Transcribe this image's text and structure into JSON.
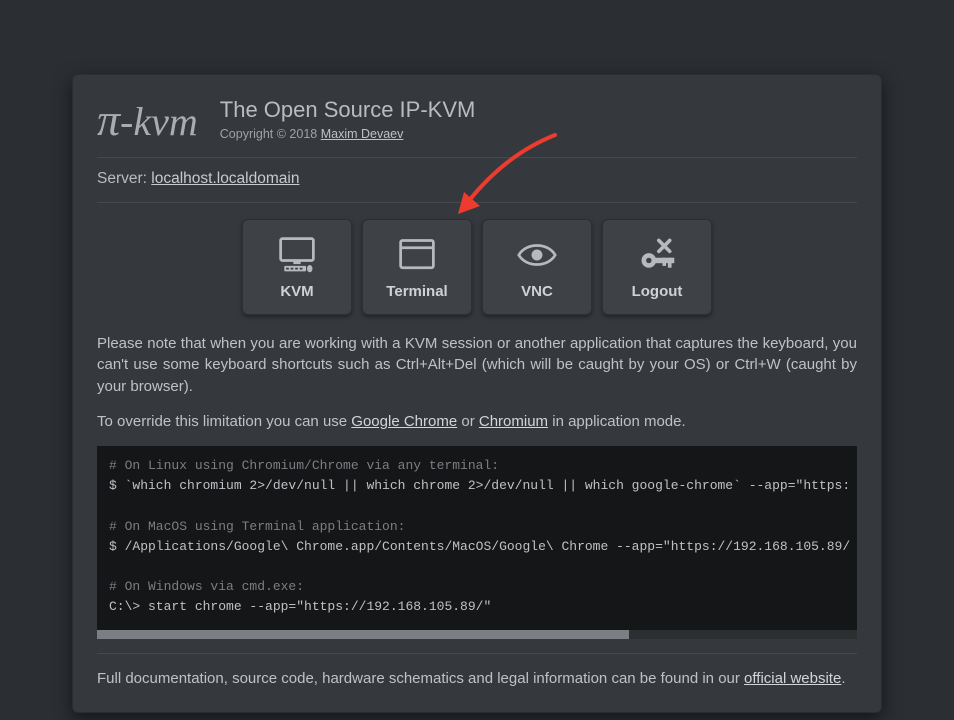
{
  "header": {
    "logo_prefix": "π",
    "logo_suffix": "-kvm",
    "title": "The Open Source IP-KVM",
    "copyright_prefix": "Copyright © 2018 ",
    "author": "Maxim Devaev"
  },
  "server": {
    "label": "Server: ",
    "host": "localhost.localdomain"
  },
  "tiles": {
    "kvm": {
      "label": "KVM"
    },
    "terminal": {
      "label": "Terminal"
    },
    "vnc": {
      "label": "VNC"
    },
    "logout": {
      "label": "Logout"
    }
  },
  "note": {
    "p1": "Please note that when you are working with a KVM session or another application that captures the keyboard, you can't use some keyboard shortcuts such as Ctrl+Alt+Del (which will be caught by your OS) or Ctrl+W (caught by your browser).",
    "p2_a": "To override this limitation you can use ",
    "p2_link1": "Google Chrome",
    "p2_b": " or ",
    "p2_link2": "Chromium",
    "p2_c": " in application mode."
  },
  "code": {
    "l1_c": "# On Linux using Chromium/Chrome via any terminal:",
    "l1": "$ `which chromium 2>/dev/null || which chrome 2>/dev/null || which google-chrome` --app=\"https:",
    "l2_c": "# On MacOS using Terminal application:",
    "l2": "$ /Applications/Google\\ Chrome.app/Contents/MacOS/Google\\ Chrome --app=\"https://192.168.105.89/",
    "l3_c": "# On Windows via cmd.exe:",
    "l3": "C:\\> start chrome --app=\"https://192.168.105.89/\""
  },
  "footer": {
    "a": "Full documentation, source code, hardware schematics and legal information can be found in our ",
    "link": "official website",
    "b": "."
  }
}
